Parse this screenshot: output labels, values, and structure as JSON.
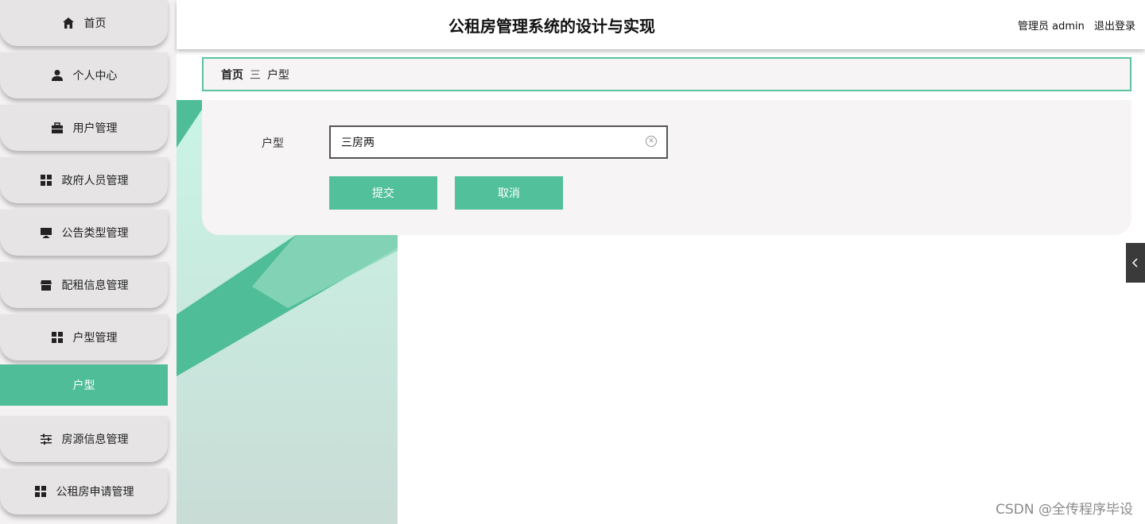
{
  "sidebar": {
    "items": [
      {
        "label": "首页",
        "icon": "home-icon"
      },
      {
        "label": "个人中心",
        "icon": "person-icon"
      },
      {
        "label": "用户管理",
        "icon": "briefcase-icon"
      },
      {
        "label": "政府人员管理",
        "icon": "grid-icon"
      },
      {
        "label": "公告类型管理",
        "icon": "monitor-icon"
      },
      {
        "label": "配租信息管理",
        "icon": "store-icon"
      },
      {
        "label": "户型管理",
        "icon": "grid-icon"
      },
      {
        "label": "房源信息管理",
        "icon": "sliders-icon"
      },
      {
        "label": "公租房申请管理",
        "icon": "grid-icon"
      }
    ],
    "active_sub": "户型"
  },
  "header": {
    "title": "公租房管理系统的设计与实现",
    "user_label": "管理员 admin",
    "logout_label": "退出登录"
  },
  "breadcrumb": {
    "home": "首页",
    "separator": "三",
    "current": "户型"
  },
  "form": {
    "field_label": "户型",
    "field_value": "三房两",
    "submit_label": "提交",
    "cancel_label": "取消"
  },
  "watermark": "CSDN @全传程序毕设",
  "colors": {
    "accent": "#52c19b",
    "sidebar_bg": "#e6e4e4",
    "collapse_tab": "#3a3a3a"
  }
}
